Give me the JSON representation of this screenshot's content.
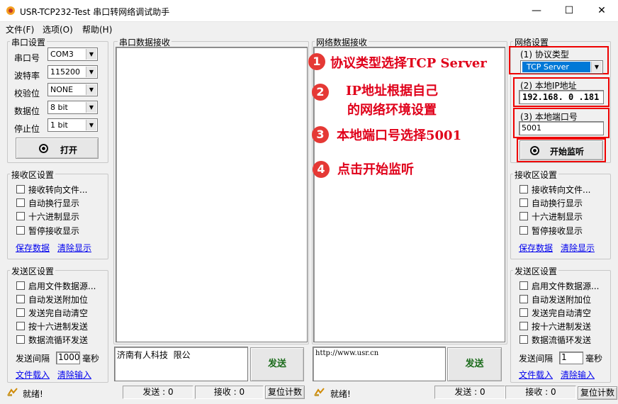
{
  "window": {
    "title": "USR-TCP232-Test 串口转网络调试助手",
    "minimize": "—",
    "maximize": "☐",
    "close": "✕"
  },
  "menu": [
    "文件(F)",
    "选项(O)",
    "帮助(H)"
  ],
  "serial": {
    "legend": "串口设置",
    "fields": [
      {
        "label": "串口号",
        "value": "COM3"
      },
      {
        "label": "波特率",
        "value": "115200"
      },
      {
        "label": "校验位",
        "value": "NONE"
      },
      {
        "label": "数据位",
        "value": "8 bit"
      },
      {
        "label": "停止位",
        "value": "1 bit"
      }
    ],
    "open_button": "打开"
  },
  "left_recv": {
    "legend": "接收区设置",
    "options": [
      "接收转向文件...",
      "自动换行显示",
      "十六进制显示",
      "暂停接收显示"
    ],
    "save": "保存数据",
    "clear": "清除显示"
  },
  "left_send": {
    "legend": "发送区设置",
    "options": [
      "启用文件数据源...",
      "自动发送附加位",
      "发送完自动清空",
      "按十六进制发送",
      "数据流循环发送"
    ],
    "interval_label": "发送间隔",
    "interval_value": "1000",
    "interval_unit": "毫秒",
    "load": "文件载入",
    "clear": "清除输入"
  },
  "serial_recv_legend": "串口数据接收",
  "net_recv_legend": "网络数据接收",
  "serial_send_text": "济南有人科技   限公",
  "net_send_text": "http://www.usr.cn",
  "send_button": "发送",
  "net": {
    "legend": "网络设置",
    "protocol_label": "(1) 协议类型",
    "protocol_value": "TCP Server",
    "ip_label": "(2) 本地IP地址",
    "ip_value": "192.168. 0 .181",
    "port_label": "(3) 本地端口号",
    "port_value": "5001",
    "listen_button": "开始监听"
  },
  "right_recv": {
    "legend": "接收区设置",
    "options": [
      "接收转向文件...",
      "自动换行显示",
      "十六进制显示",
      "暂停接收显示"
    ],
    "save": "保存数据",
    "clear": "清除显示"
  },
  "right_send": {
    "legend": "发送区设置",
    "options": [
      "启用文件数据源...",
      "自动发送附加位",
      "发送完自动清空",
      "按十六进制发送",
      "数据流循环发送"
    ],
    "interval_label": "发送间隔",
    "interval_value": "1",
    "interval_unit": "毫秒",
    "load": "文件载入",
    "clear": "清除输入"
  },
  "annotations": [
    {
      "num": "1",
      "text": "协议类型选择TCP Server"
    },
    {
      "num": "2",
      "text": "IP地址根据自己"
    },
    {
      "num": "",
      "text": "的网络环境设置"
    },
    {
      "num": "3",
      "text": "本地端口号选择5001"
    },
    {
      "num": "4",
      "text": "点击开始监听"
    }
  ],
  "status_left": {
    "ready": "就绪!",
    "sent": "发送 : 0",
    "recv": "接收 : 0",
    "reset": "复位计数"
  },
  "status_right": {
    "ready": "就绪!",
    "sent": "发送 : 0",
    "recv": "接收 : 0",
    "reset": "复位计数"
  },
  "colors": {
    "annotation": "#e0001a",
    "selection": "#0078d7"
  }
}
